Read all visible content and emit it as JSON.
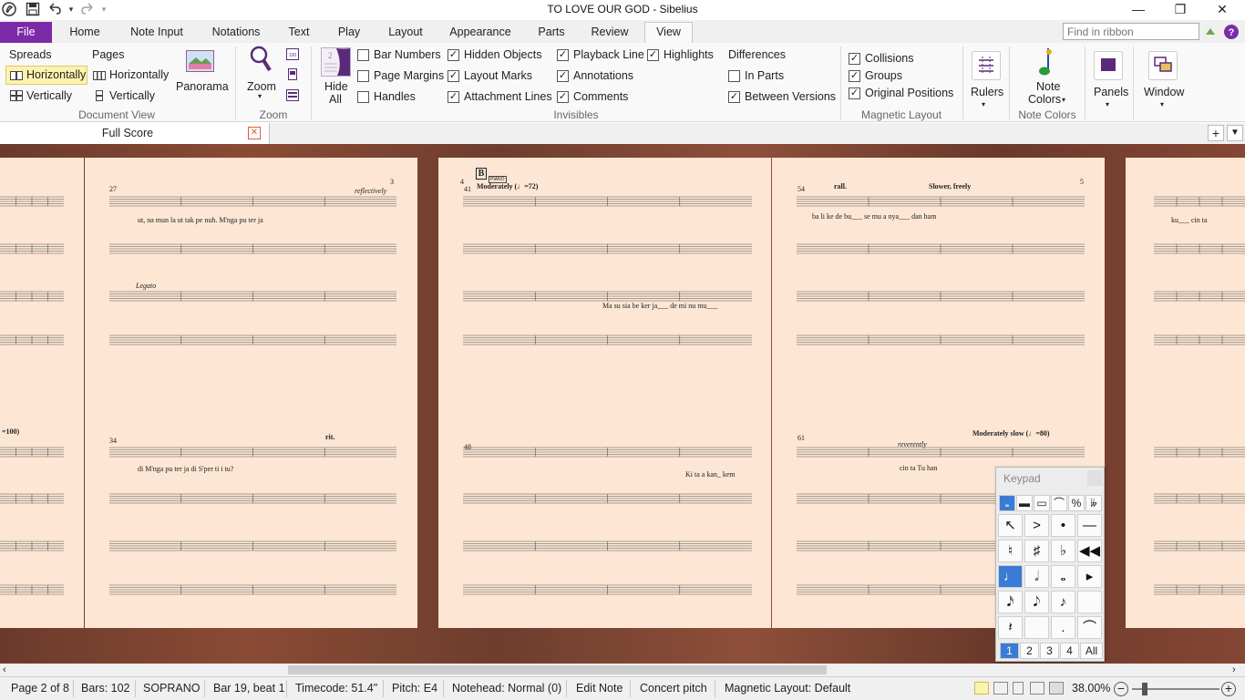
{
  "window": {
    "title": "TO LOVE OUR GOD - Sibelius",
    "minimize": "—",
    "maximize": "❐",
    "close": "✕"
  },
  "quick_access": {
    "app_icon": "sibelius-logo-icon",
    "save": "save-icon",
    "undo": "undo-icon",
    "redo": "redo-icon",
    "customize": "dropdown-icon"
  },
  "ribbon_tabs": [
    "File",
    "Home",
    "Note Input",
    "Notations",
    "Text",
    "Play",
    "Layout",
    "Appearance",
    "Parts",
    "Review",
    "View"
  ],
  "active_tab": "View",
  "search": {
    "placeholder": "Find in ribbon"
  },
  "ribbon": {
    "document_view": {
      "label": "Document View",
      "spreads": "Spreads",
      "pages": "Pages",
      "spreads_horizontally": "Horizontally",
      "spreads_vertically": "Vertically",
      "pages_horizontally": "Horizontally",
      "pages_vertically": "Vertically",
      "panorama": "Panorama"
    },
    "zoom": {
      "label": "Zoom",
      "zoom": "Zoom"
    },
    "invisibles": {
      "label": "Invisibles",
      "hide_all_line1": "Hide",
      "hide_all_line2": "All",
      "bar_numbers": "Bar Numbers",
      "page_margins": "Page Margins",
      "handles": "Handles",
      "hidden_objects": "Hidden Objects",
      "layout_marks": "Layout Marks",
      "attachment_lines": "Attachment Lines",
      "playback_line": "Playback Line",
      "annotations": "Annotations",
      "comments": "Comments",
      "highlights": "Highlights",
      "differences": "Differences",
      "in_parts": "In Parts",
      "between_versions": "Between Versions"
    },
    "magnetic_layout": {
      "label": "Magnetic Layout",
      "collisions": "Collisions",
      "groups": "Groups",
      "original_positions": "Original Positions"
    },
    "rulers": "Rulers",
    "note_colors": {
      "label": "Note Colors",
      "line1": "Note",
      "line2": "Colors"
    },
    "panels": "Panels",
    "window": "Window"
  },
  "doc_tab": {
    "title": "Full Score",
    "close": "✕"
  },
  "score_pages": [
    {
      "page_no": "3",
      "rehearsal": "",
      "bars_top": "27",
      "bars_bottom": "34",
      "expr": "reflectively",
      "tempo": "",
      "rit": "rit."
    },
    {
      "page_no": "4",
      "rehearsal": "B",
      "bars_top": "41",
      "bars_bottom": "48",
      "expr": "",
      "tempo": "Moderately (♩=72)",
      "rit": ""
    },
    {
      "page_no": "5",
      "rehearsal": "",
      "bars_top": "54",
      "bars_bottom": "61",
      "expr": "reverently",
      "tempo": "Slower, freely",
      "rit": "rall."
    }
  ],
  "score_text": {
    "legato": "Legato",
    "moderately_slow": "Moderately slow (♩=80)",
    "piano_box": "PIANO",
    "tempo_left": "=100)",
    "lyrics_a": "ut,   na mun   la   ut   tak   pe   nuh.        M'nga pu ter ja",
    "lyrics_b": "di    M'nga pu ter ja    di    S'per    ti    i    tu?",
    "lyrics_c": "Ma  su  sia be ker ja___  de mi nu    mu___",
    "lyrics_d": "Ki   ta  a  kan_  kem",
    "lyrics_e": "ba  li  ke  de  bu___    se  mu  a  nya___    dan  ham",
    "lyrics_f": "cin  ta    Tu    han",
    "lyrics_g": "ku___     cin ta"
  },
  "keypad": {
    "title": "Keypad",
    "row1": [
      "𝅝",
      "▬",
      "▭",
      "⌒",
      "%",
      "𝄫"
    ],
    "rows": [
      [
        "↖",
        ">",
        "•",
        "—"
      ],
      [
        "♮",
        "♯",
        "♭",
        "◀◀"
      ],
      [
        "♩",
        "𝅗𝅥",
        "𝅝",
        "▸"
      ],
      [
        "𝅘𝅥𝅯",
        "𝅘𝅥𝅮",
        "♪",
        ""
      ],
      [
        "𝄽",
        "",
        ".",
        "⌒"
      ]
    ],
    "layouts": [
      "1",
      "2",
      "3",
      "4",
      "All"
    ],
    "active_layout": "1"
  },
  "status": {
    "page": "Page 2 of 8",
    "bars": "Bars: 102",
    "instrument": "SOPRANO",
    "position": "Bar 19, beat 1",
    "timecode": "Timecode: 51.4\"",
    "pitch": "Pitch: E4",
    "notehead": "Notehead: Normal (0)",
    "mode": "Edit Note",
    "concert": "Concert pitch",
    "magnetic": "Magnetic Layout: Default",
    "zoom": "38.00%"
  },
  "colors": {
    "accent": "#7b2aa8",
    "page": "#fde6d3",
    "desk": "#7a4230",
    "keypad_active": "#3a7bd5"
  }
}
